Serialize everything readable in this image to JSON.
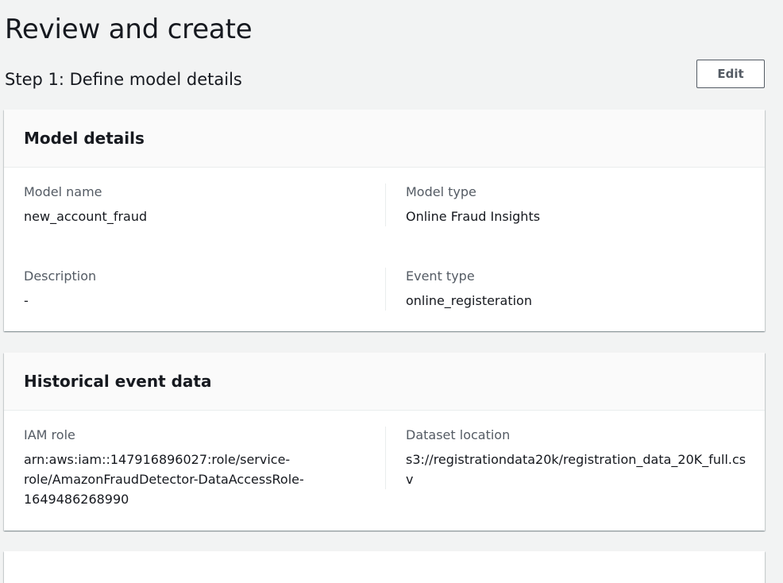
{
  "page": {
    "title": "Review and create"
  },
  "step1": {
    "title": "Step 1: Define model details",
    "edit_label": "Edit"
  },
  "model_details": {
    "title": "Model details",
    "model_name_label": "Model name",
    "model_name_value": "new_account_fraud",
    "model_type_label": "Model type",
    "model_type_value": "Online Fraud Insights",
    "description_label": "Description",
    "description_value": "-",
    "event_type_label": "Event type",
    "event_type_value": "online_registeration"
  },
  "historical_data": {
    "title": "Historical event data",
    "iam_role_label": "IAM role",
    "iam_role_value": "arn:aws:iam::147916896027:role/service-role/AmazonFraudDetector-DataAccessRole-1649486268990",
    "dataset_location_label": "Dataset location",
    "dataset_location_value": "s3://registrationdata20k/registration_data_20K_full.csv"
  },
  "colors": {
    "background": "#f2f3f3",
    "card": "#ffffff",
    "text": "#16191f",
    "secondary_text": "#545b64"
  }
}
